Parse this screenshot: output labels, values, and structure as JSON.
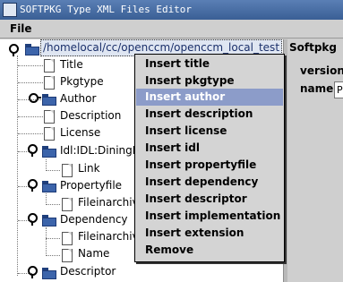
{
  "window": {
    "title": "SOFTPKG Type XML Files Editor"
  },
  "menu": {
    "file_label": "File"
  },
  "tree": {
    "root_path": "/homelocal/cc/openccm/openccm_local_test",
    "nodes": [
      {
        "label": "Title",
        "kind": "file"
      },
      {
        "label": "Pkgtype",
        "kind": "file"
      },
      {
        "label": "Author",
        "kind": "folder"
      },
      {
        "label": "Description",
        "kind": "file"
      },
      {
        "label": "License",
        "kind": "file"
      },
      {
        "label": "Idl:IDL:DiningPhilosophers",
        "kind": "folder"
      },
      {
        "label": "Link",
        "kind": "file"
      },
      {
        "label": "Propertyfile",
        "kind": "folder"
      },
      {
        "label": "Fileinarchive",
        "kind": "file"
      },
      {
        "label": "Dependency",
        "kind": "folder"
      },
      {
        "label": "Fileinarchive",
        "kind": "file"
      },
      {
        "label": "Name",
        "kind": "file"
      },
      {
        "label": "Descriptor",
        "kind": "folder"
      }
    ]
  },
  "right_panel": {
    "header": "Softpkg",
    "version_label": "version",
    "name_label": "name :",
    "name_value": "P"
  },
  "context_menu": {
    "items": [
      "Insert title",
      "Insert pkgtype",
      "Insert author",
      "Insert description",
      "Insert license",
      "Insert idl",
      "Insert propertyfile",
      "Insert dependency",
      "Insert descriptor",
      "Insert implementation",
      "Insert extension",
      "Remove"
    ],
    "highlighted": "Insert author"
  }
}
